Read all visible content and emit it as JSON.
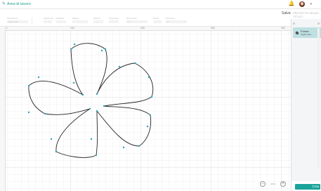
{
  "app": {
    "title": "Area di lavoro"
  },
  "header": {
    "save": "Salva",
    "project_name": "PROGETTO SENZA TITOLO"
  },
  "toolbar": {
    "groups": [
      {
        "label": "Operazione",
        "value": "Taglio base"
      },
      {
        "label": "Seleziona",
        "value": ""
      },
      {
        "label": "Modifica",
        "value": ""
      },
      {
        "label": "Allinea",
        "value": ""
      },
      {
        "label": "Disponi",
        "value": ""
      },
      {
        "label": "Capovolgi",
        "value": ""
      },
      {
        "label": "Dimensioni",
        "value": "L  A"
      },
      {
        "label": "Ruota",
        "value": ""
      },
      {
        "label": "Posizione",
        "value": "X  Y"
      }
    ]
  },
  "ruler": {
    "ticks": [
      "1",
      "100",
      "200",
      "300",
      "400"
    ]
  },
  "zoom": {
    "value": "100%",
    "out": "−",
    "in": "+"
  },
  "layers": {
    "item_name": "Forma",
    "item_sub": "Taglio base"
  },
  "action": {
    "label": "Crea"
  },
  "colors": {
    "accent": "#1aa39a",
    "layer_bg": "#bfe0e2",
    "node": "#2aa7b8"
  },
  "icons": [
    "pencil-icon",
    "bell-icon",
    "avatar",
    "chevron-down-icon",
    "layer-shape-icon"
  ]
}
